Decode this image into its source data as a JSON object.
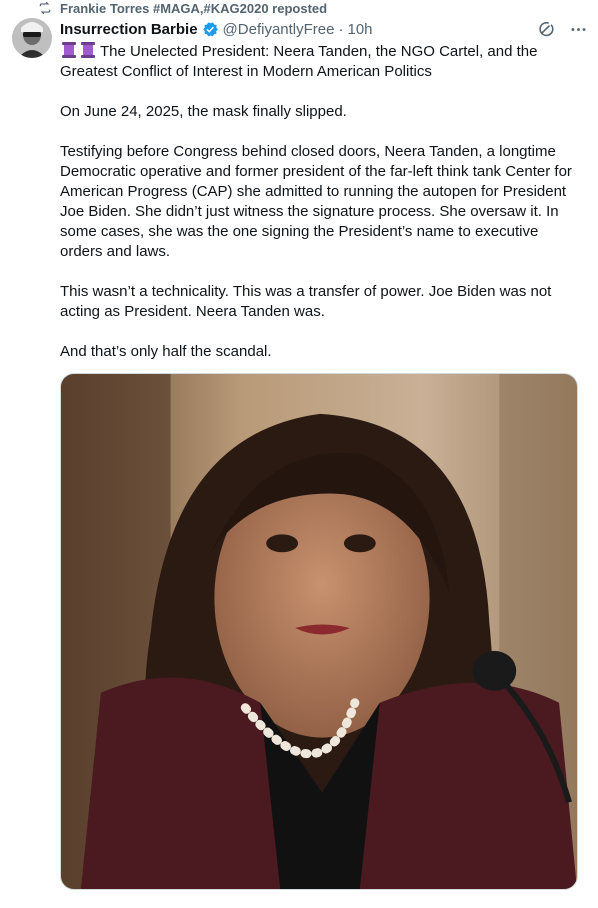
{
  "repost": {
    "icon": "repost-icon",
    "text": "Frankie Torres #MAGA,#KAG2020 reposted"
  },
  "post": {
    "author_name": "Insurrection Barbie",
    "verified_icon": "verified-badge-icon",
    "handle": "@DefiyantlyFree",
    "separator": "·",
    "time": "10h",
    "title_icons": [
      "purple-spool-icon",
      "purple-spool-icon"
    ],
    "paragraphs": [
      "The Unelected President: Neera Tanden, the NGO Cartel, and the Greatest Conflict of Interest in Modern American Politics",
      "On June 24, 2025, the mask finally slipped.",
      "Testifying before Congress behind closed doors, Neera Tanden, a longtime Democratic operative and former president of the far-left think tank Center for American Progress (CAP) she admitted to running the autopen for President Joe Biden. She didn’t just witness the signature process. She oversaw it. In some cases, she was the one signing the President’s name to executive orders and laws.",
      "This wasn’t a technicality. This was a transfer of power. Joe Biden was not acting as President. Neera Tanden was.",
      "And that’s only half the scandal."
    ],
    "media_icon": "photo-of-woman-at-hearing-microphone"
  },
  "colors": {
    "text": "#0f1419",
    "secondary": "#536471",
    "verified": "#1d9bf0",
    "grok": "#536471"
  }
}
